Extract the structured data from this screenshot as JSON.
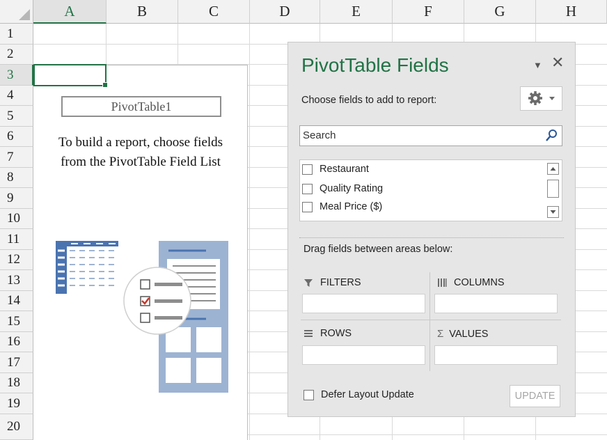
{
  "columns": [
    "A",
    "B",
    "C",
    "D",
    "E",
    "F",
    "G",
    "H"
  ],
  "rows": [
    "1",
    "2",
    "3",
    "4",
    "5",
    "6",
    "7",
    "8",
    "9",
    "10",
    "11",
    "12",
    "13",
    "14",
    "15",
    "16",
    "17",
    "18",
    "19",
    "20"
  ],
  "active_cell": {
    "column": "A",
    "row": "3"
  },
  "pivot_placeholder": {
    "name": "PivotTable1",
    "instruction_line1": "To build a report, choose fields",
    "instruction_line2": "from the PivotTable Field List"
  },
  "panel": {
    "title": "PivotTable Fields",
    "choose_label": "Choose fields to add to report:",
    "search": {
      "placeholder": "Search"
    },
    "fields": [
      {
        "label": "Restaurant",
        "checked": false
      },
      {
        "label": "Quality Rating",
        "checked": false
      },
      {
        "label": "Meal Price ($)",
        "checked": false
      }
    ],
    "drag_label": "Drag fields between areas below:",
    "areas": {
      "filters": "FILTERS",
      "columns": "COLUMNS",
      "rows": "ROWS",
      "values": "VALUES"
    },
    "defer_label": "Defer Layout Update",
    "update_label": "UPDATE"
  },
  "icons": {
    "filter": "filter-icon",
    "columns": "columns-icon",
    "rows": "rows-icon",
    "values": "sigma-icon",
    "search": "search-icon",
    "gear": "gear-icon"
  },
  "colors": {
    "accent": "#217346",
    "panel_bg": "#e6e6e6",
    "illustration": "#4a74b0"
  }
}
